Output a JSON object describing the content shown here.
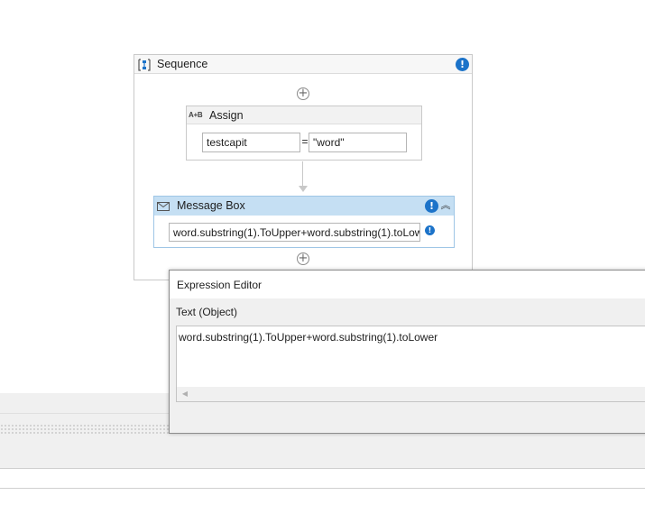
{
  "sequence": {
    "title": "Sequence",
    "warn_glyph": "!"
  },
  "designer": {
    "add_glyph": "+"
  },
  "assign": {
    "title": "Assign",
    "icon_text": "A+B",
    "to": "testcapit",
    "equals": "=",
    "value": "\"word\""
  },
  "message_box": {
    "title": "Message Box",
    "text": "word.substring(1).ToUpper+word.substring(1).toLower",
    "warn_glyph": "!",
    "collapse_glyph": "︽"
  },
  "expression_editor": {
    "title": "Expression Editor",
    "label": "Text (Object)",
    "expression": "word.substring(1).ToUpper+word.substring(1).toLower",
    "scroll_left_glyph": "◀"
  },
  "colors": {
    "accent_blue": "#1c73c9",
    "message_box_header": "#c5dff3",
    "panel_gray": "#f0f0f0"
  }
}
